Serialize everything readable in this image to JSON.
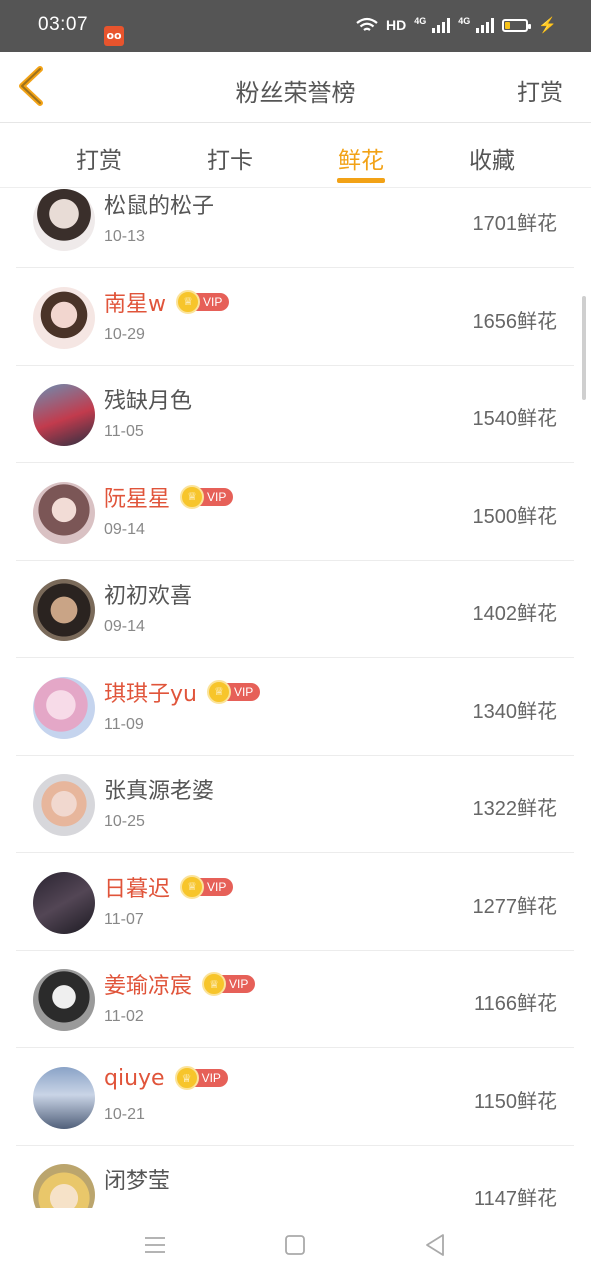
{
  "status_bar": {
    "time": "03:07",
    "app_icon": "app-notification-icon",
    "network_hd": "HD",
    "net_1": "4G",
    "net_2": "4G",
    "battery_level": 0.25
  },
  "header": {
    "back_icon": "chevron-left-icon",
    "title": "粉丝荣誉榜",
    "action_label": "打赏"
  },
  "tabs": [
    {
      "label": "打赏",
      "active": false
    },
    {
      "label": "打卡",
      "active": false
    },
    {
      "label": "鲜花",
      "active": true
    },
    {
      "label": "收藏",
      "active": false
    }
  ],
  "vip_label": "VIP",
  "list": [
    {
      "name": "松鼠的松子",
      "date": "10-13",
      "count": "1701鲜花",
      "vip": false
    },
    {
      "name": "南星w",
      "date": "10-29",
      "count": "1656鲜花",
      "vip": true
    },
    {
      "name": "残缺月色",
      "date": "11-05",
      "count": "1540鲜花",
      "vip": false
    },
    {
      "name": "阮星星",
      "date": "09-14",
      "count": "1500鲜花",
      "vip": true
    },
    {
      "name": "初初欢喜",
      "date": "09-14",
      "count": "1402鲜花",
      "vip": false
    },
    {
      "name": "琪琪子yu",
      "date": "11-09",
      "count": "1340鲜花",
      "vip": true
    },
    {
      "name": "张真源老婆",
      "date": "10-25",
      "count": "1322鲜花",
      "vip": false
    },
    {
      "name": "日暮迟",
      "date": "11-07",
      "count": "1277鲜花",
      "vip": true
    },
    {
      "name": "姜瑜凉宸",
      "date": "11-02",
      "count": "1166鲜花",
      "vip": true
    },
    {
      "name": "qiuye",
      "date": "10-21",
      "count": "1150鲜花",
      "vip": true
    },
    {
      "name": "闭梦莹",
      "date": "",
      "count": "1147鲜花",
      "vip": false
    }
  ],
  "colors": {
    "accent": "#f2a216",
    "vip_name": "#e0543a",
    "vip_tag": "#e66058",
    "crown": "#f7c52b"
  },
  "navbar": {
    "menu_icon": "menu-icon",
    "home_icon": "home-square-icon",
    "back_icon": "back-triangle-icon"
  }
}
